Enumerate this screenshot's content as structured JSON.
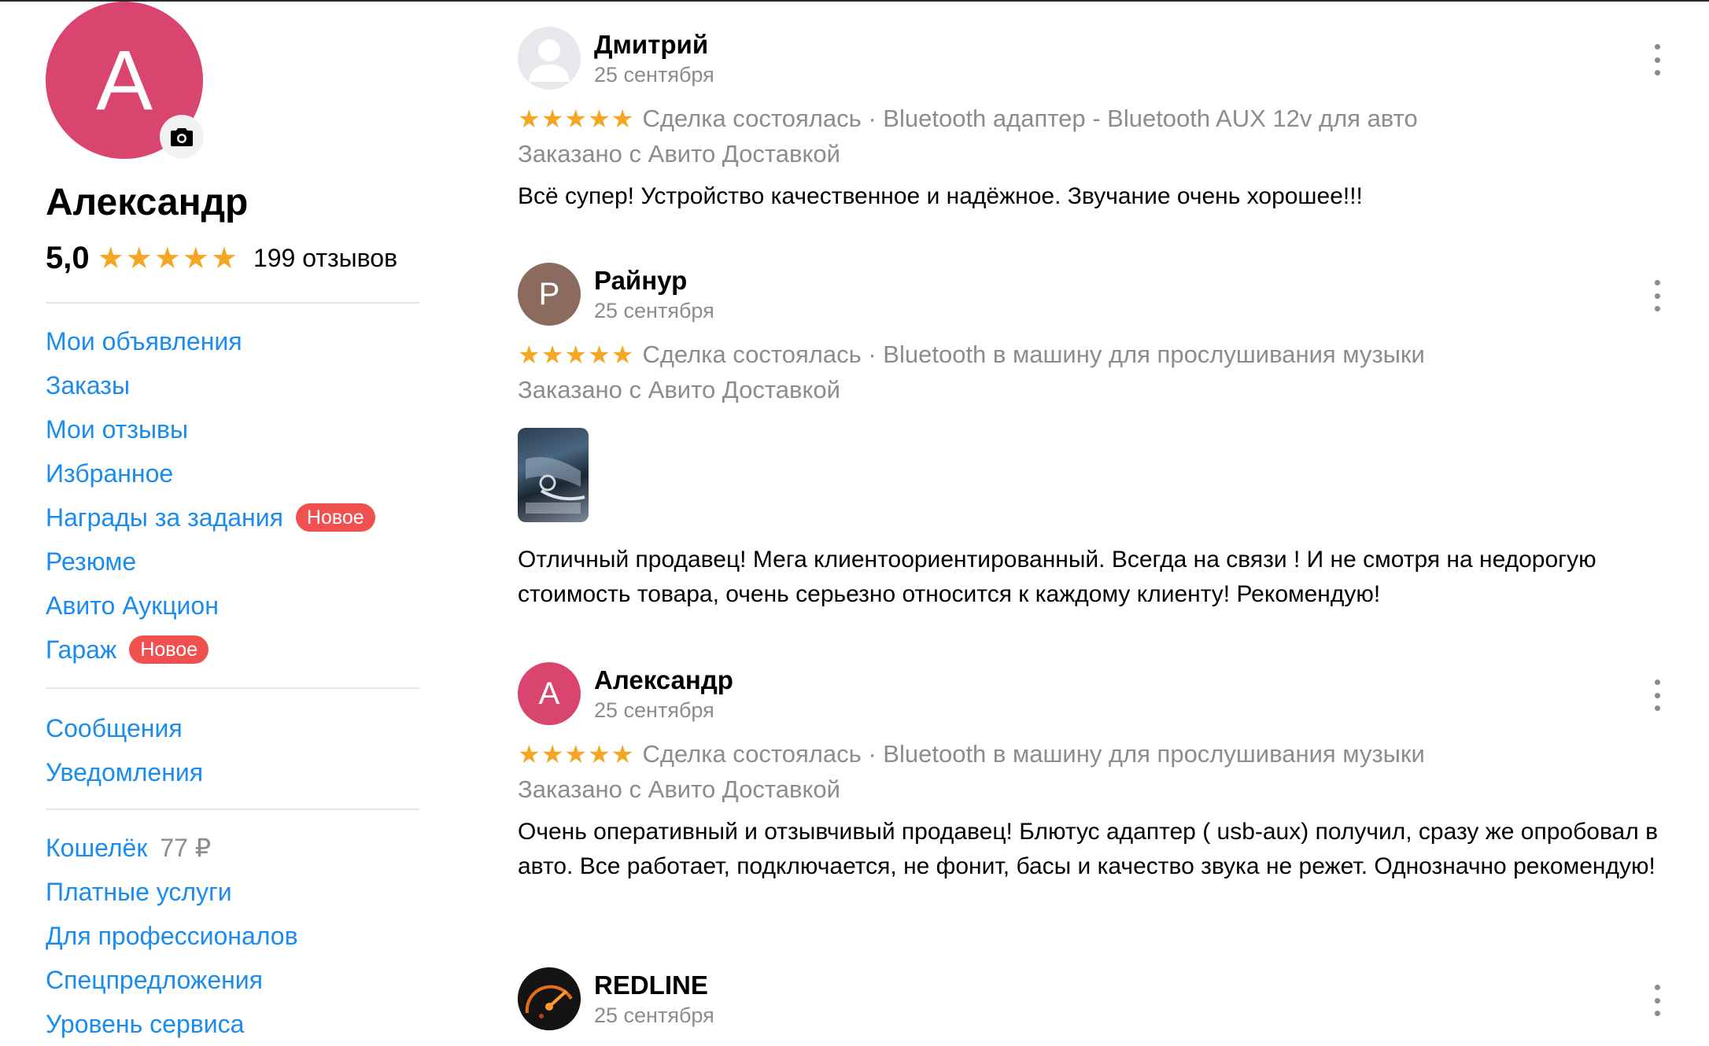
{
  "profile": {
    "avatar_letter": "А",
    "name": "Александр",
    "rating": "5,0",
    "stars": "★★★★★",
    "reviews_count": "199 отзывов",
    "avatar_color": "#d9456e"
  },
  "menu": {
    "group1": [
      {
        "label": "Мои объявления"
      },
      {
        "label": "Заказы"
      },
      {
        "label": "Мои отзывы"
      },
      {
        "label": "Избранное"
      },
      {
        "label": "Награды за задания",
        "badge": "Новое"
      },
      {
        "label": "Резюме"
      },
      {
        "label": "Авито Аукцион"
      },
      {
        "label": "Гараж",
        "badge": "Новое"
      }
    ],
    "group2": [
      {
        "label": "Сообщения"
      },
      {
        "label": "Уведомления"
      }
    ],
    "group3": [
      {
        "label": "Кошелёк",
        "amount": "77 ₽"
      },
      {
        "label": "Платные услуги"
      },
      {
        "label": "Для профессионалов"
      },
      {
        "label": "Спецпредложения"
      },
      {
        "label": "Уровень сервиса"
      }
    ]
  },
  "reviews": [
    {
      "name": "Дмитрий",
      "date": "25 сентября",
      "stars": "★★★★★",
      "deal": "Сделка состоялась · Bluetooth адаптер - Bluetooth AUX 12v для авто",
      "delivery": "Заказано с Авито Доставкой",
      "text": "Всё супер! Устройство качественное и надёжное. Звучание очень хорошее!!!"
    },
    {
      "name": "Райнур",
      "avatar_letter": "Р",
      "date": "25 сентября",
      "stars": "★★★★★",
      "deal": "Сделка состоялась · Bluetooth в машину для прослушивания музыки",
      "delivery": "Заказано с Авито Доставкой",
      "text": "Отличный продавец! Мега клиентоориентированный. Всегда на связи ! И не смотря на недорогую стоимость товара, очень серьезно относится к каждому клиенту! Рекомендую!"
    },
    {
      "name": "Александр",
      "avatar_letter": "А",
      "date": "25 сентября",
      "stars": "★★★★★",
      "deal": "Сделка состоялась · Bluetooth в машину для прослушивания музыки",
      "delivery": "Заказано с Авито Доставкой",
      "text": "Очень оперативный и отзывчивый продавец! Блютус адаптер ( usb-aux) получил, сразу же опробовал в авто. Все работает, подключается, не фонит, басы и качество звука не режет. Однозначно рекомендую!"
    },
    {
      "name": "REDLINE",
      "date": "25 сентября"
    }
  ],
  "colors": {
    "link": "#1a8cef",
    "star": "#f5a623",
    "badge": "#f0504f",
    "muted": "#8c8c8c",
    "avatar_brown": "#8a6b5e",
    "avatar_pink": "#d9456e"
  }
}
